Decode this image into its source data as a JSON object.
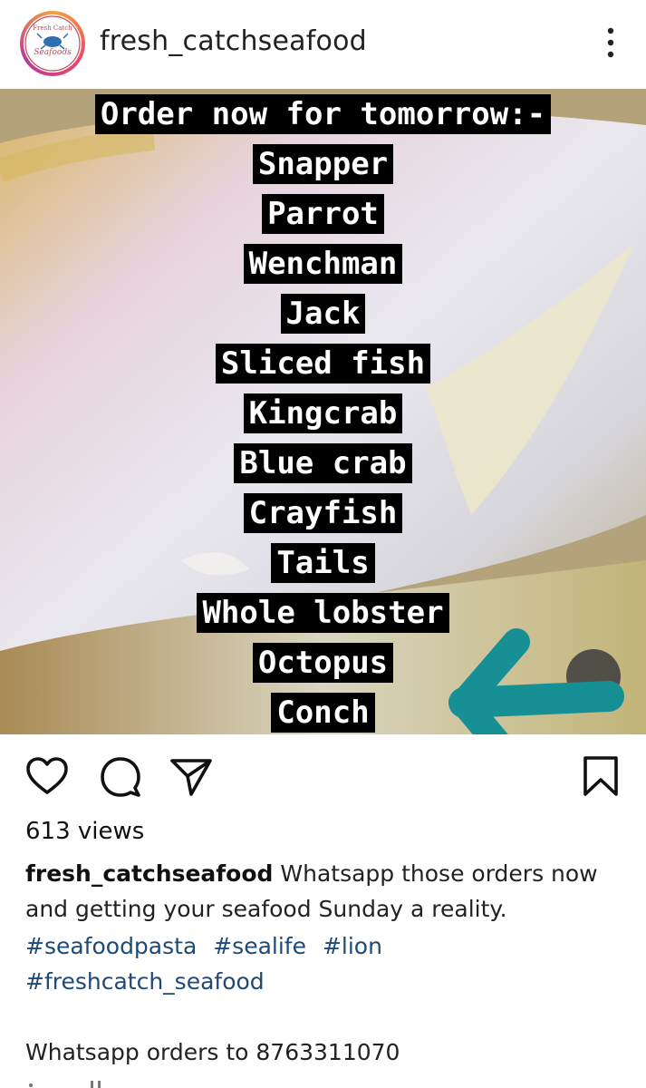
{
  "header": {
    "username": "fresh_catchseafood",
    "avatar_lines": [
      "Fresh Catch",
      "Seafoods"
    ],
    "more_icon": "vertical-ellipsis-icon"
  },
  "post": {
    "headline": "Order now for tomorrow:-",
    "items": [
      "Snapper",
      "Parrot",
      "Wenchman",
      "Jack",
      "Sliced fish",
      "Kingcrab",
      "Blue crab",
      "Crayfish",
      "Tails",
      "Whole lobster",
      "Octopus",
      "Conch"
    ],
    "arrow_color": "#168f95"
  },
  "actions": {
    "like_icon": "heart-icon",
    "comment_icon": "comment-icon",
    "share_icon": "send-icon",
    "save_icon": "bookmark-icon"
  },
  "stats": {
    "views": "613 views"
  },
  "caption": {
    "username": "fresh_catchseafood",
    "text": "Whatsapp those orders now and getting your seafood Sunday a reality.",
    "hashtags": [
      "#seafoodpasta",
      "#sealife",
      "#lion",
      "#freshcatch_seafood"
    ],
    "whatsapp_line": "Whatsapp orders to 8763311070"
  }
}
